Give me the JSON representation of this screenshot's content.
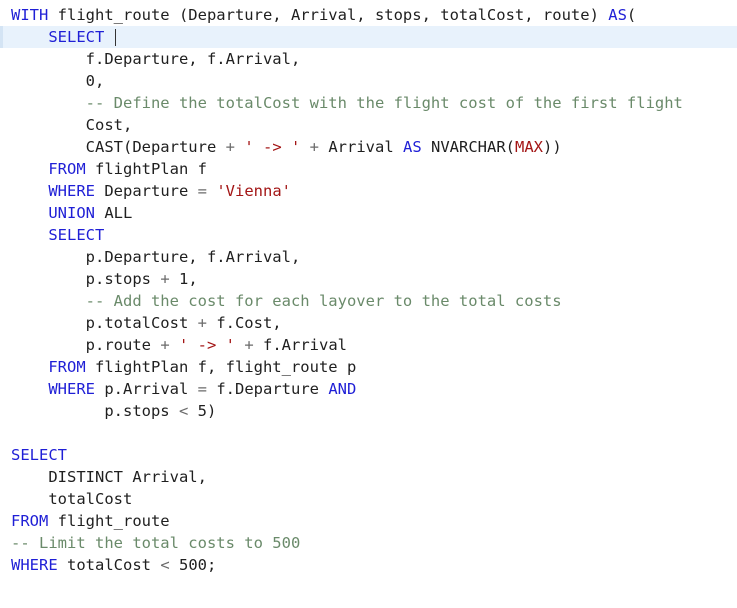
{
  "editor": {
    "language": "sql",
    "colors": {
      "keyword": "#1f1fd6",
      "string": "#a31515",
      "comment": "#6a8a6a",
      "operator": "#6b6b6b",
      "text": "#1f1f1f",
      "current_line": "#e8f2fc"
    },
    "lines": [
      [
        [
          "kw",
          "WITH"
        ],
        [
          "t",
          " flight_route (Departure, Arrival, stops, totalCost, route) "
        ],
        [
          "kw",
          "AS"
        ],
        [
          "t",
          "("
        ]
      ],
      [
        [
          "t",
          "    "
        ],
        [
          "kw",
          "SELECT"
        ],
        [
          "t",
          " "
        ]
      ],
      [
        [
          "t",
          "        f.Departure, f.Arrival,"
        ]
      ],
      [
        [
          "t",
          "        0,"
        ]
      ],
      [
        [
          "t",
          "        "
        ],
        [
          "cmt",
          "-- Define the totalCost with the flight cost of the first flight"
        ]
      ],
      [
        [
          "t",
          "        Cost,"
        ]
      ],
      [
        [
          "t",
          "        CAST(Departure "
        ],
        [
          "op",
          "+"
        ],
        [
          "t",
          " "
        ],
        [
          "str",
          "' -> '"
        ],
        [
          "t",
          " "
        ],
        [
          "op",
          "+"
        ],
        [
          "t",
          " Arrival "
        ],
        [
          "kw",
          "AS"
        ],
        [
          "t",
          " NVARCHAR("
        ],
        [
          "str",
          "MAX"
        ],
        [
          "t",
          "))"
        ]
      ],
      [
        [
          "t",
          "    "
        ],
        [
          "kw",
          "FROM"
        ],
        [
          "t",
          " flightPlan f"
        ]
      ],
      [
        [
          "t",
          "    "
        ],
        [
          "kw",
          "WHERE"
        ],
        [
          "t",
          " Departure "
        ],
        [
          "op",
          "="
        ],
        [
          "t",
          " "
        ],
        [
          "str",
          "'Vienna'"
        ]
      ],
      [
        [
          "t",
          "    "
        ],
        [
          "kw",
          "UNION"
        ],
        [
          "t",
          " ALL"
        ]
      ],
      [
        [
          "t",
          "    "
        ],
        [
          "kw",
          "SELECT"
        ]
      ],
      [
        [
          "t",
          "        p.Departure, f.Arrival,"
        ]
      ],
      [
        [
          "t",
          "        p.stops "
        ],
        [
          "op",
          "+"
        ],
        [
          "t",
          " 1,"
        ]
      ],
      [
        [
          "t",
          "        "
        ],
        [
          "cmt",
          "-- Add the cost for each layover to the total costs"
        ]
      ],
      [
        [
          "t",
          "        p.totalCost "
        ],
        [
          "op",
          "+"
        ],
        [
          "t",
          " f.Cost,"
        ]
      ],
      [
        [
          "t",
          "        p.route "
        ],
        [
          "op",
          "+"
        ],
        [
          "t",
          " "
        ],
        [
          "str",
          "' -> '"
        ],
        [
          "t",
          " "
        ],
        [
          "op",
          "+"
        ],
        [
          "t",
          " f.Arrival"
        ]
      ],
      [
        [
          "t",
          "    "
        ],
        [
          "kw",
          "FROM"
        ],
        [
          "t",
          " flightPlan f, flight_route p"
        ]
      ],
      [
        [
          "t",
          "    "
        ],
        [
          "kw",
          "WHERE"
        ],
        [
          "t",
          " p.Arrival "
        ],
        [
          "op",
          "="
        ],
        [
          "t",
          " f.Departure "
        ],
        [
          "kw",
          "AND"
        ]
      ],
      [
        [
          "t",
          "          p.stops "
        ],
        [
          "op",
          "<"
        ],
        [
          "t",
          " 5)"
        ]
      ],
      [],
      [
        [
          "kw",
          "SELECT"
        ]
      ],
      [
        [
          "t",
          "    DISTINCT Arrival,"
        ]
      ],
      [
        [
          "t",
          "    totalCost"
        ]
      ],
      [
        [
          "kw",
          "FROM"
        ],
        [
          "t",
          " flight_route"
        ]
      ],
      [
        [
          "cmt",
          "-- Limit the total costs to 500"
        ]
      ],
      [
        [
          "kw",
          "WHERE"
        ],
        [
          "t",
          " totalCost "
        ],
        [
          "op",
          "<"
        ],
        [
          "t",
          " 500;"
        ]
      ]
    ]
  }
}
